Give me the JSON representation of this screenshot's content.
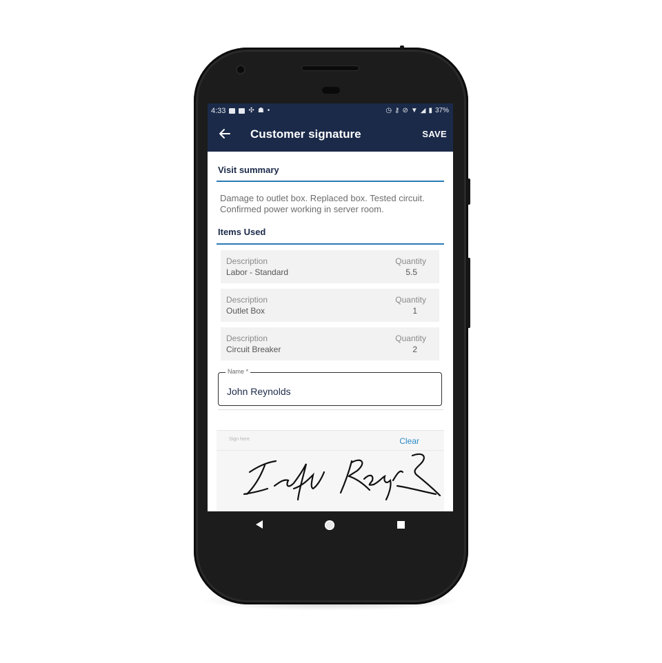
{
  "status_bar": {
    "time": "4:33",
    "battery": "37%",
    "icons_left": [
      "image-icon",
      "save-icon",
      "pinwheel-icon",
      "hat-icon",
      "dot-icon"
    ],
    "icons_right": [
      "alarm-icon",
      "vpn-key-icon",
      "notifications-off-icon",
      "wifi-icon",
      "signal-icon",
      "battery-icon"
    ]
  },
  "app_bar": {
    "back_icon": "arrow-back-icon",
    "title": "Customer signature",
    "save_label": "SAVE"
  },
  "visit_summary": {
    "heading": "Visit summary",
    "text": "Damage to outlet box. Replaced box. Tested circuit. Confirmed power working in server room."
  },
  "items_used": {
    "heading": "Items Used",
    "description_label": "Description",
    "quantity_label": "Quantity",
    "items": [
      {
        "description": "Labor - Standard",
        "quantity": "5.5"
      },
      {
        "description": "Outlet Box",
        "quantity": "1"
      },
      {
        "description": "Circuit Breaker",
        "quantity": "2"
      }
    ]
  },
  "name_field": {
    "label": "Name *",
    "value": "John Reynolds"
  },
  "signature_pad": {
    "hint": "Sign here",
    "clear_label": "Clear"
  },
  "colors": {
    "app_bar": "#1b2a49",
    "accent_rule": "#2a7ab5",
    "link": "#2a8bc7"
  },
  "nav_bar": {
    "buttons": [
      "back-triangle-icon",
      "home-circle-icon",
      "recents-square-icon"
    ]
  }
}
